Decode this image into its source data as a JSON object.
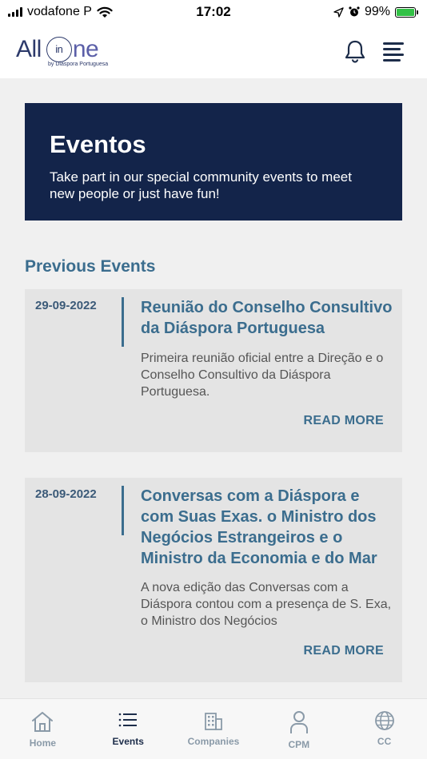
{
  "status_bar": {
    "carrier": "vodafone P",
    "time": "17:02",
    "battery": "99%"
  },
  "header": {
    "logo_text_all": "All",
    "logo_text_in": "in",
    "logo_text_one": "ne",
    "logo_subtitle": "by Diáspora Portuguesa"
  },
  "hero": {
    "title": "Eventos",
    "text": "Take part in our special community events to meet new people or just have fun!"
  },
  "section_title": "Previous Events",
  "events": [
    {
      "date": "29-09-2022",
      "title": "Reunião do Conselho Consultivo da Diáspora Portuguesa",
      "description": "Primeira reunião oficial entre a Direção e o Conselho Consultivo da Diáspora Portuguesa.",
      "read_more": "READ MORE"
    },
    {
      "date": "28-09-2022",
      "title": "Conversas com a Diáspora e com Suas Exas. o Ministro dos Negócios Estrangeiros e o Ministro da Economia e do Mar",
      "description": "A nova edição das Conversas com a Diáspora contou com a presença de S. Exa, o Ministro dos Negócios",
      "read_more": "READ MORE"
    }
  ],
  "bottom_nav": [
    {
      "label": "Home",
      "icon": "home-icon"
    },
    {
      "label": "Events",
      "icon": "list-icon"
    },
    {
      "label": "Companies",
      "icon": "building-icon"
    },
    {
      "label": "CPM",
      "icon": "person-icon"
    },
    {
      "label": "CC",
      "icon": "globe-icon"
    }
  ],
  "colors": {
    "hero_bg": "#13244a",
    "accent": "#3b6d8e",
    "nav_active": "#1d2d4a",
    "nav_inactive": "#8a9aa8"
  }
}
